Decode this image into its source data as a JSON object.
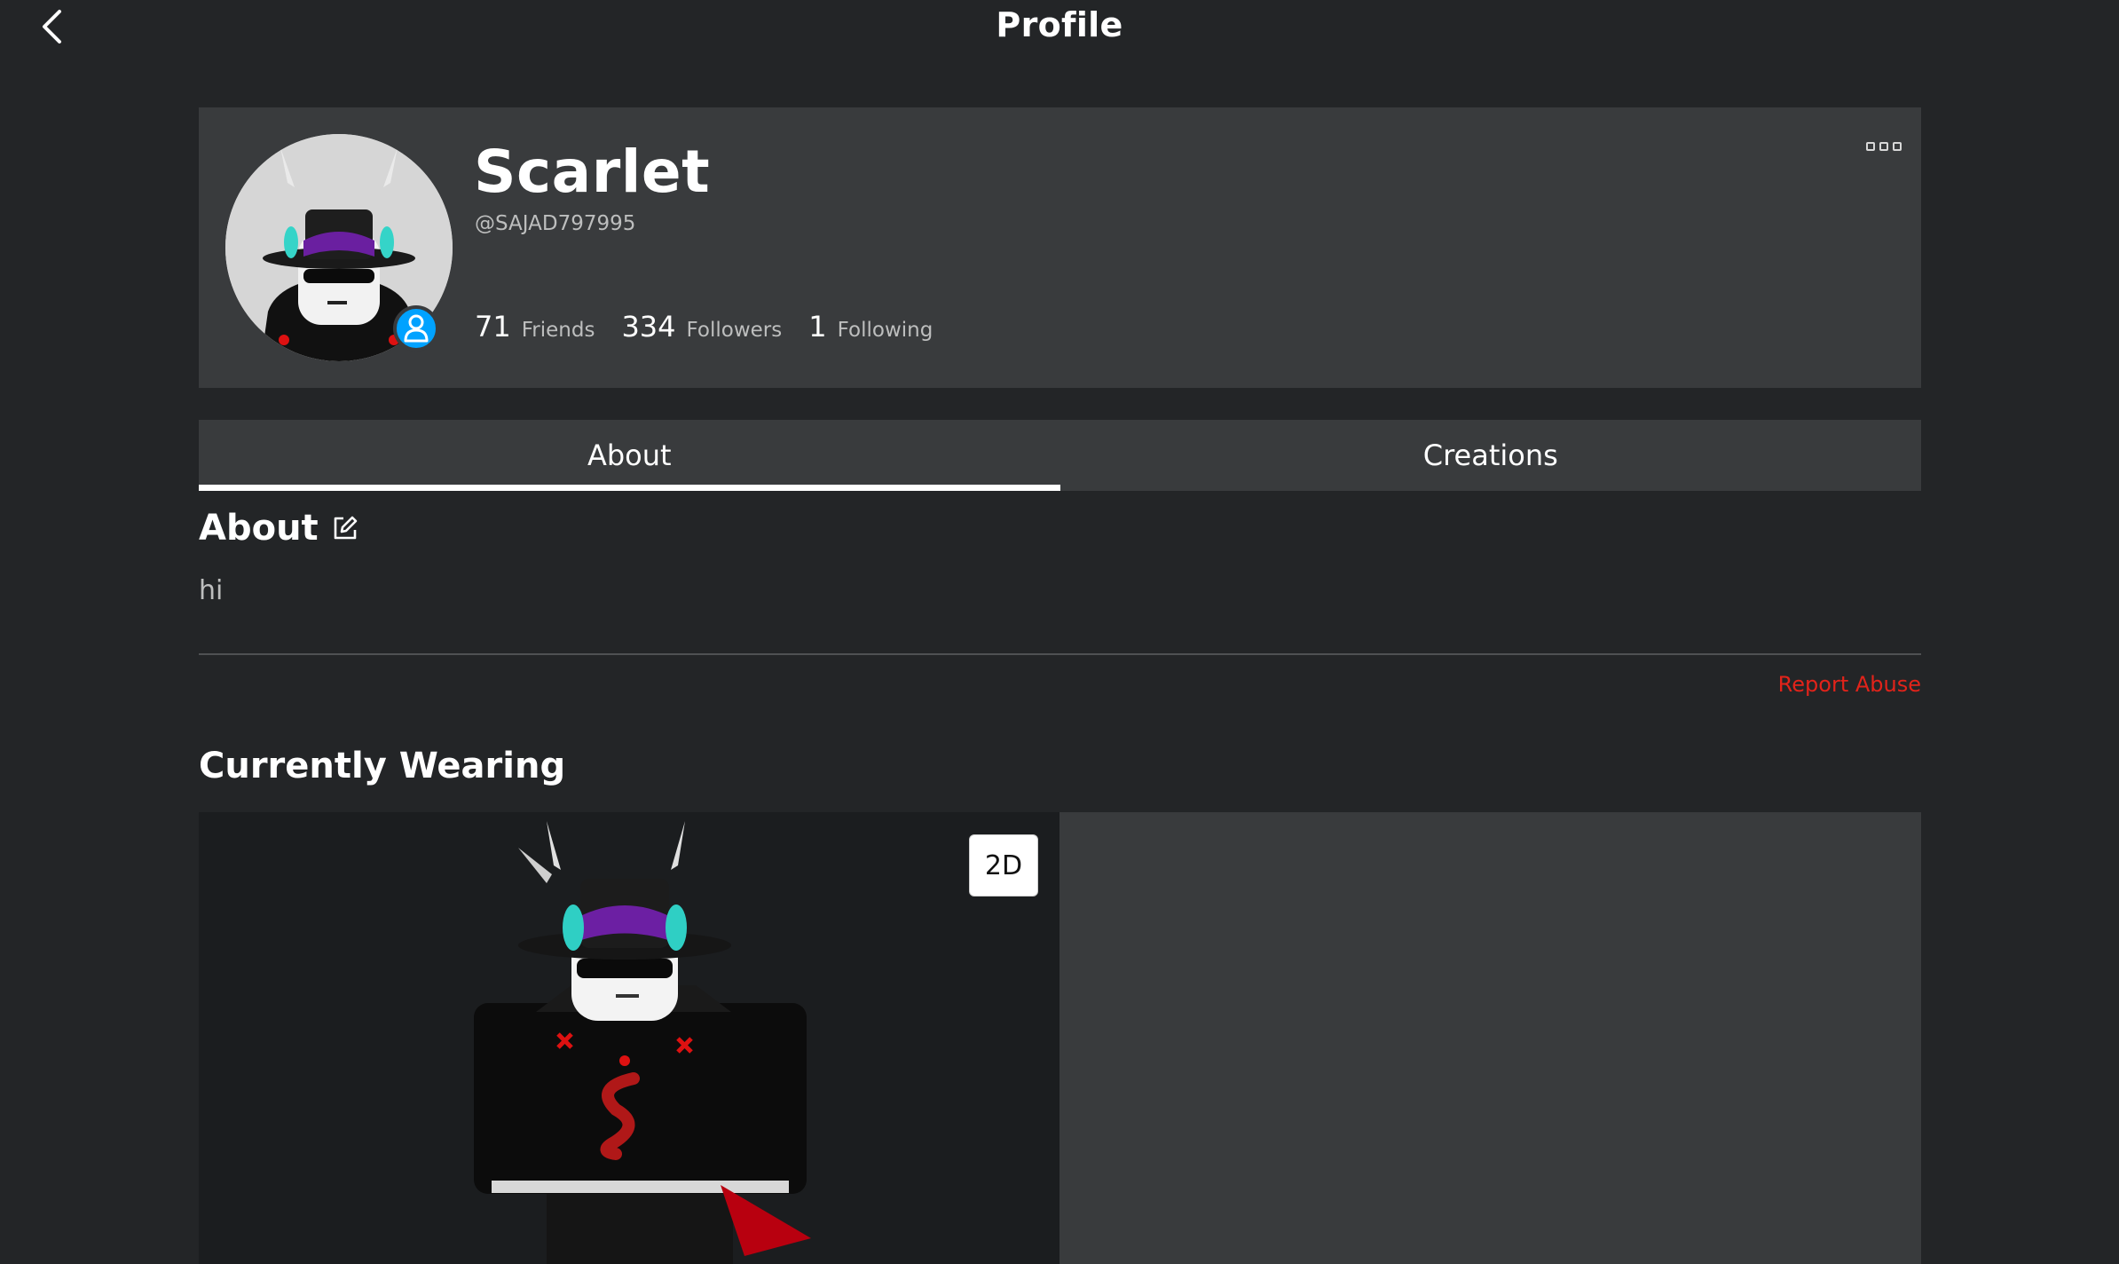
{
  "header": {
    "title": "Profile"
  },
  "profile": {
    "display_name": "Scarlet",
    "username": "@SAJAD797995",
    "stats": [
      {
        "count": "71",
        "label": "Friends"
      },
      {
        "count": "334",
        "label": "Followers"
      },
      {
        "count": "1",
        "label": "Following"
      }
    ]
  },
  "tabs": [
    {
      "label": "About",
      "active": true
    },
    {
      "label": "Creations",
      "active": false
    }
  ],
  "about": {
    "title": "About",
    "text": "hi",
    "report_label": "Report Abuse"
  },
  "wearing": {
    "title": "Currently Wearing",
    "toggle_label": "2D"
  },
  "colors": {
    "background": "#232527",
    "card": "#393b3d",
    "presence": "#00a2ff",
    "report": "#e2231a"
  },
  "icons": {
    "back": "chevron-left-icon",
    "more": "more-options-icon",
    "edit": "edit-icon",
    "presence": "user-presence-icon"
  }
}
